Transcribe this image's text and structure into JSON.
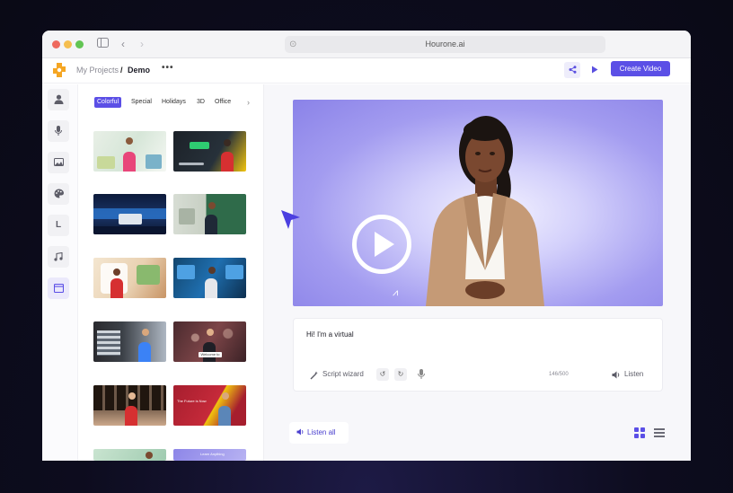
{
  "browser": {
    "url": "Hourone.ai"
  },
  "header": {
    "breadcrumb_root": "My Projects",
    "breadcrumb_sep": "/",
    "breadcrumb_current": "Demo",
    "more": "•••",
    "create_label": "Create Video"
  },
  "rail": {
    "items": [
      {
        "name": "avatar",
        "icon": "person-icon"
      },
      {
        "name": "voice",
        "icon": "mic-icon"
      },
      {
        "name": "image",
        "icon": "image-icon"
      },
      {
        "name": "style",
        "icon": "palette-icon"
      },
      {
        "name": "layout",
        "glyph": "L"
      },
      {
        "name": "music",
        "icon": "music-icon"
      },
      {
        "name": "templates",
        "icon": "template-icon"
      }
    ]
  },
  "templates": {
    "filters": [
      "Colorful",
      "Special",
      "Holidays",
      "3D",
      "Office"
    ],
    "active_filter": "Colorful",
    "thumb_captions": [
      "Welcome to Brand",
      "The Future is Now",
      "Learn Anything"
    ]
  },
  "script": {
    "text": "Hi! I'm a virtual",
    "wizard_label": "Script wizard",
    "count": "146/500",
    "listen_label": "Listen"
  },
  "footer": {
    "listen_all_label": "Listen all"
  },
  "colors": {
    "accent": "#5b4fe6",
    "backdrop": "#0d0c1e"
  }
}
